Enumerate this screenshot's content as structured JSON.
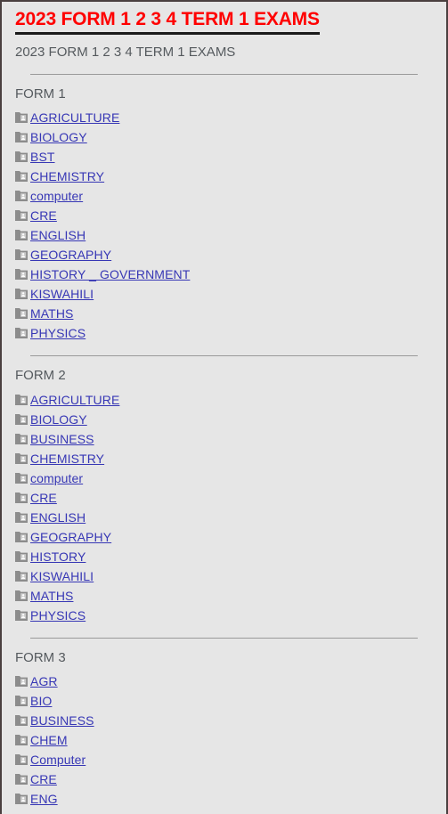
{
  "colors": {
    "title": "#ff0000",
    "title_underline": "#1a1a1a",
    "link": "#3737b5",
    "heading_text": "#555a5e",
    "background": "#e6e6e6",
    "divider": "#9a9a9a",
    "folder_icon": "#8c8c8c",
    "window_border": "#4a3f3f"
  },
  "header": {
    "title": "2023 FORM 1 2 3 4 TERM 1 EXAMS",
    "subtitle": "2023 FORM 1 2 3 4 TERM 1 EXAMS"
  },
  "icons": {
    "folder": "folder-user-icon"
  },
  "sections": [
    {
      "heading": "FORM 1",
      "items": [
        {
          "label": "AGRICULTURE"
        },
        {
          "label": "BIOLOGY"
        },
        {
          "label": "BST"
        },
        {
          "label": "CHEMISTRY"
        },
        {
          "label": "computer"
        },
        {
          "label": "CRE"
        },
        {
          "label": "ENGLISH"
        },
        {
          "label": "GEOGRAPHY"
        },
        {
          "label": "HISTORY _ GOVERNMENT"
        },
        {
          "label": "KISWAHILI"
        },
        {
          "label": "MATHS"
        },
        {
          "label": "PHYSICS"
        }
      ]
    },
    {
      "heading": "FORM 2",
      "items": [
        {
          "label": "AGRICULTURE"
        },
        {
          "label": "BIOLOGY"
        },
        {
          "label": "BUSINESS"
        },
        {
          "label": "CHEMISTRY"
        },
        {
          "label": "computer"
        },
        {
          "label": "CRE"
        },
        {
          "label": "ENGLISH"
        },
        {
          "label": "GEOGRAPHY"
        },
        {
          "label": "HISTORY"
        },
        {
          "label": "KISWAHILI"
        },
        {
          "label": "MATHS"
        },
        {
          "label": "PHYSICS"
        }
      ]
    },
    {
      "heading": "FORM 3",
      "items": [
        {
          "label": "AGR"
        },
        {
          "label": "BIO"
        },
        {
          "label": "BUSINESS"
        },
        {
          "label": "CHEM"
        },
        {
          "label": "Computer"
        },
        {
          "label": "CRE"
        },
        {
          "label": "ENG"
        }
      ]
    }
  ]
}
